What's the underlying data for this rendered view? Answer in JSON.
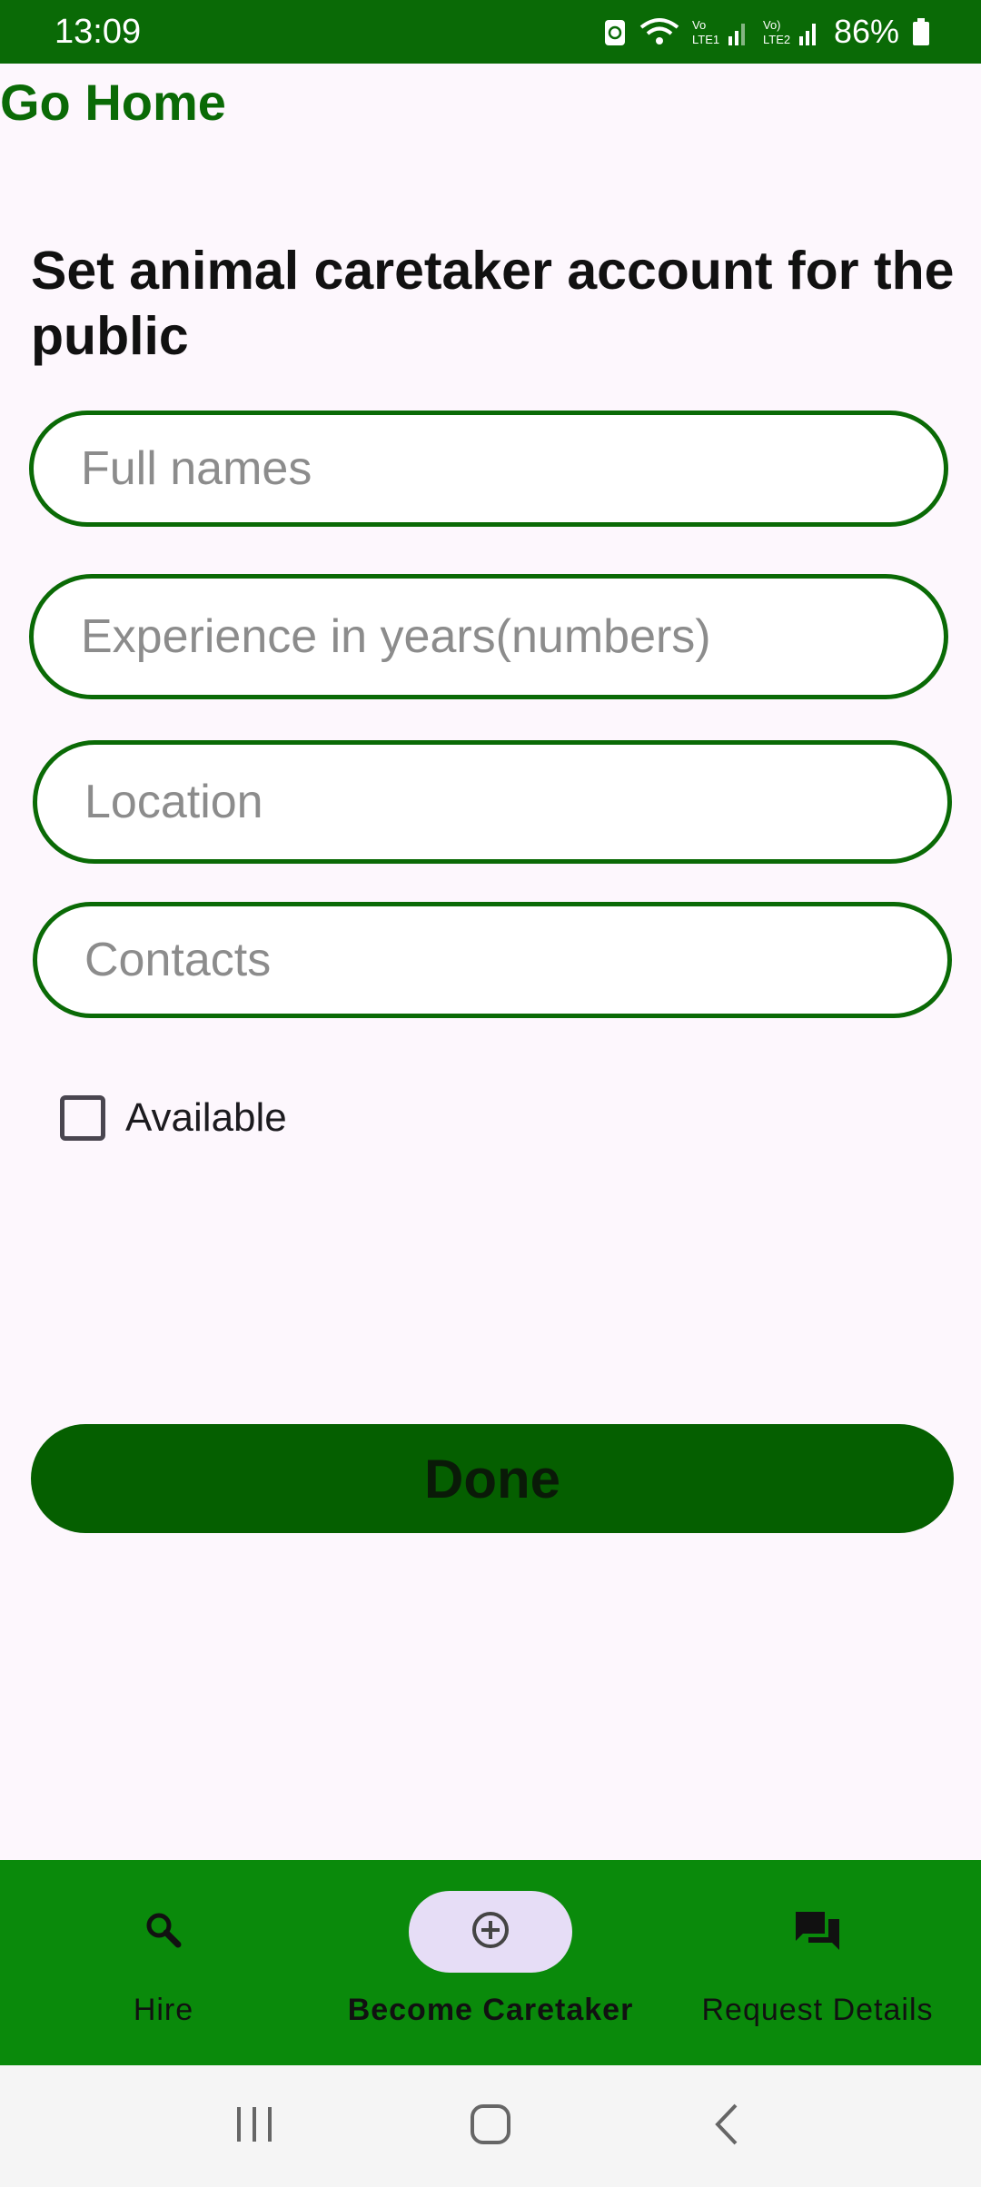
{
  "status_bar": {
    "time": "13:09",
    "battery": "86%"
  },
  "header": {
    "go_home": "Go Home",
    "title": "Set animal caretaker account for the public"
  },
  "form": {
    "full_names_placeholder": "Full names",
    "experience_placeholder": "Experience in years(numbers)",
    "location_placeholder": "Location",
    "contacts_placeholder": "Contacts",
    "available_label": "Available",
    "available_checked": false,
    "done_label": "Done"
  },
  "bottom_nav": {
    "items": [
      {
        "label": "Hire",
        "icon": "search-icon",
        "active": false
      },
      {
        "label": "Become Caretaker",
        "icon": "add-circle-icon",
        "active": true
      },
      {
        "label": "Request Details",
        "icon": "chat-icon",
        "active": false
      }
    ]
  },
  "colors": {
    "primary_green": "#0a6a06",
    "nav_green": "#0a8a0b",
    "active_pill": "#e6ddf6"
  }
}
